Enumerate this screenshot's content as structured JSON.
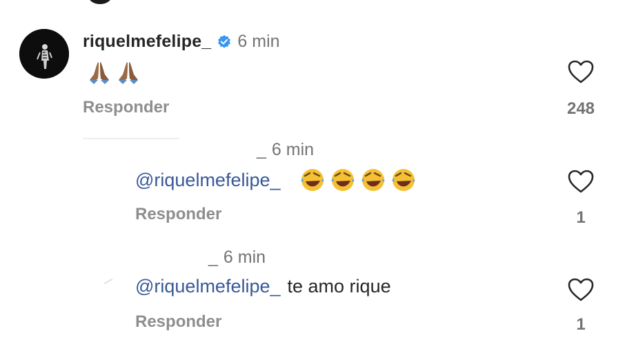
{
  "comments": [
    {
      "username": "riquelmefelipe_",
      "verified": true,
      "time": "6 min",
      "text": "",
      "emoji": [
        "praying-hands",
        "praying-hands"
      ],
      "reply_label": "Responder",
      "likes": "248"
    },
    {
      "username": "_",
      "time": "6 min",
      "mention": "@riquelmefelipe_",
      "text": "",
      "emoji": [
        "rolling-on-floor-laughing",
        "rolling-on-floor-laughing",
        "rolling-on-floor-laughing",
        "rolling-on-floor-laughing"
      ],
      "reply_label": "Responder",
      "likes": "1"
    },
    {
      "username": "_",
      "time": "6 min",
      "mention": "@riquelmefelipe_",
      "text": "te amo rique",
      "reply_label": "Responder",
      "likes": "1"
    }
  ],
  "colors": {
    "mention": "#385898",
    "muted": "#737373",
    "verified": "#3897f0"
  }
}
